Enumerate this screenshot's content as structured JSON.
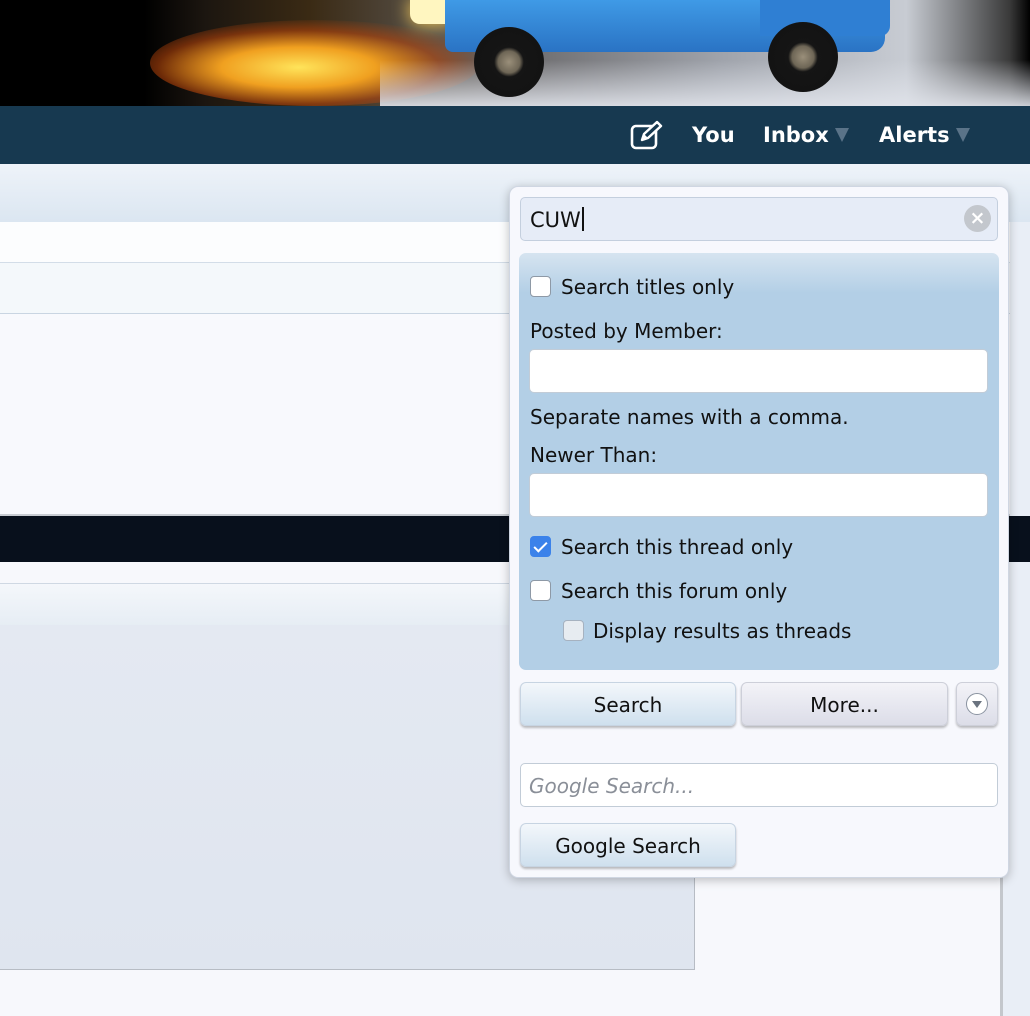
{
  "nav": {
    "compose_icon": "compose-icon",
    "you": "You",
    "inbox": "Inbox",
    "alerts": "Alerts"
  },
  "search": {
    "query": "CUW",
    "clear_icon": "clear-icon",
    "titles_only": {
      "label": "Search titles only",
      "checked": false
    },
    "posted_by_label": "Posted by Member:",
    "posted_by_value": "",
    "posted_by_hint": "Separate names with a comma.",
    "newer_than_label": "Newer Than:",
    "newer_than_value": "",
    "thread_only": {
      "label": "Search this thread only",
      "checked": true
    },
    "forum_only": {
      "label": "Search this forum only",
      "checked": false
    },
    "display_threads": {
      "label": "Display results as threads",
      "checked": false,
      "disabled": true
    },
    "search_button": "Search",
    "more_button": "More...",
    "expand_icon": "chevron-down-icon"
  },
  "google": {
    "placeholder": "Google Search...",
    "button": "Google Search"
  }
}
